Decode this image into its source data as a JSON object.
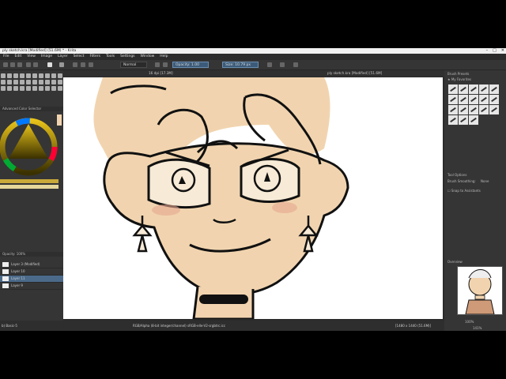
{
  "window": {
    "title": "ply sketch.kra [Modified] (51.6M) * - Krita",
    "controls": [
      "–",
      "□",
      "✕"
    ]
  },
  "menu": [
    "File",
    "Edit",
    "View",
    "Image",
    "Layer",
    "Select",
    "Filters",
    "Tools",
    "Settings",
    "Window",
    "Help"
  ],
  "toolbar": {
    "blend_mode": "Normal",
    "opacity": "Opacity: 1.00",
    "size": "Size: 10.79 px"
  },
  "left_dock": {
    "color_selector_title": "Advanced Color Selector",
    "layers_opacity": "Opacity: 100%",
    "layers": [
      {
        "name": "Layer 3 (Modified)",
        "selected": false
      },
      {
        "name": "Layer 10",
        "selected": false
      },
      {
        "name": "Layer 11",
        "selected": true
      },
      {
        "name": "Layer 9",
        "selected": false
      }
    ],
    "brush_label": "b) Basic-5"
  },
  "canvas": {
    "tabs": [
      "16 dpi [17.3M]",
      "ply sketch.kra [Modified] [51.6M]"
    ],
    "skin_color": "#f1d4af",
    "line_color": "#111111"
  },
  "right_dock": {
    "brush_presets_title": "Brush Presets",
    "tag": "★ My Favorites",
    "tool_options_title": "Tool Options",
    "smoothing_label": "Brush Smoothing:",
    "smoothing_value": "None",
    "snap_label": "Snap to Assistants",
    "overview_title": "Overview",
    "overview_zoom": "100%"
  },
  "status": {
    "color_info": "RGB/Alpha (8-bit integer/channel) sRGB-elle-V2-srgbtrc.icc",
    "dimensions": "[1480 x 1440 (51.6M)]",
    "zoom": "141%"
  }
}
